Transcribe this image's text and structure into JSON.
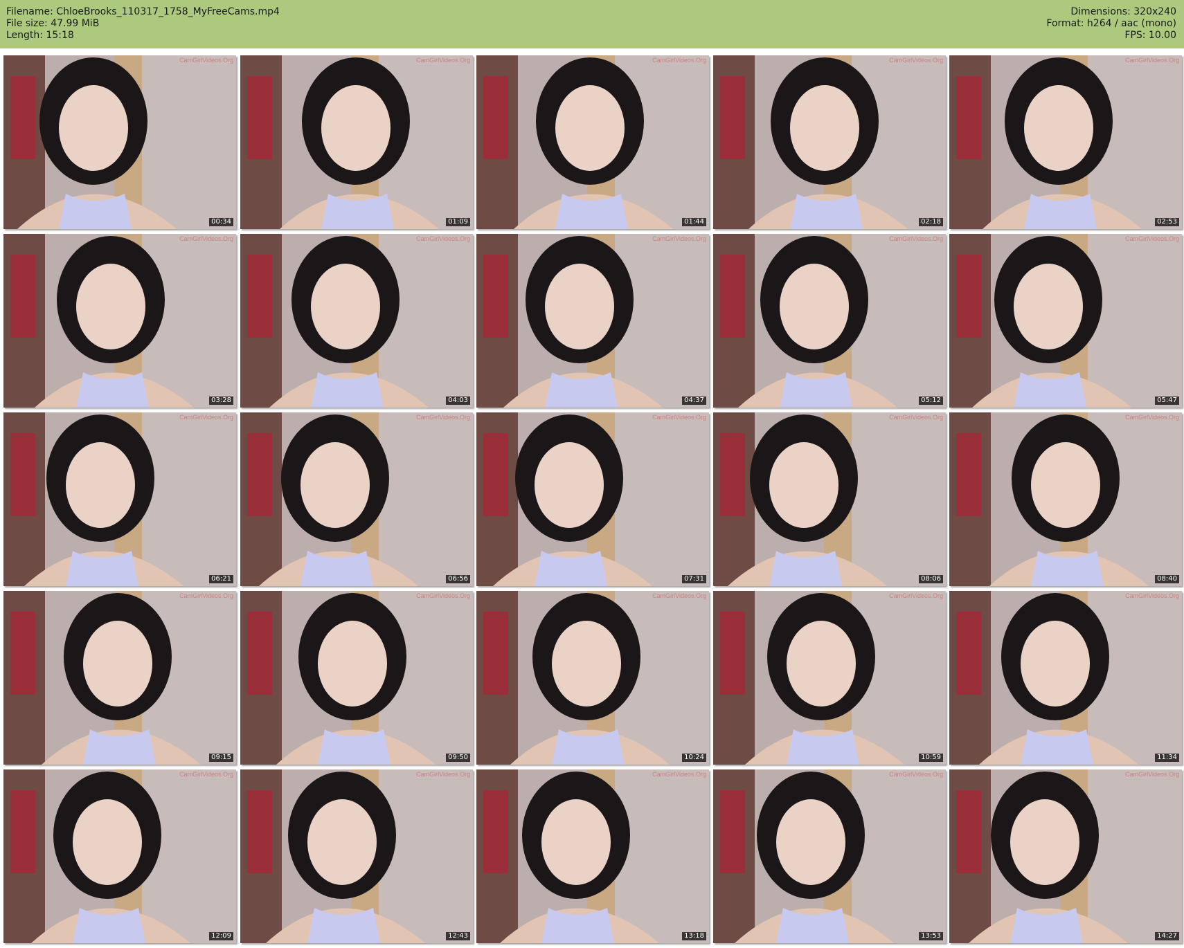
{
  "header": {
    "filename_label": "Filename: ChloeBrooks_110317_1758_MyFreeCams.mp4",
    "filesize_label": "File size: 47.99 MiB",
    "length_label": "Length: 15:18",
    "dimensions_label": "Dimensions: 320x240",
    "format_label": "Format: h264 / aac (mono)",
    "fps_label": "FPS: 10.00",
    "background_color": "#adc97e"
  },
  "watermark": "CamGirlVideos.Org",
  "thumbnails": [
    {
      "timestamp": "00:34"
    },
    {
      "timestamp": "01:09"
    },
    {
      "timestamp": "01:44"
    },
    {
      "timestamp": "02:18"
    },
    {
      "timestamp": "02:53"
    },
    {
      "timestamp": "03:28"
    },
    {
      "timestamp": "04:03"
    },
    {
      "timestamp": "04:37"
    },
    {
      "timestamp": "05:12"
    },
    {
      "timestamp": "05:47"
    },
    {
      "timestamp": "06:21"
    },
    {
      "timestamp": "06:56"
    },
    {
      "timestamp": "07:31"
    },
    {
      "timestamp": "08:06"
    },
    {
      "timestamp": "08:40"
    },
    {
      "timestamp": "09:15"
    },
    {
      "timestamp": "09:50"
    },
    {
      "timestamp": "10:24"
    },
    {
      "timestamp": "10:59"
    },
    {
      "timestamp": "11:34"
    },
    {
      "timestamp": "12:09"
    },
    {
      "timestamp": "12:43"
    },
    {
      "timestamp": "13:18"
    },
    {
      "timestamp": "13:53"
    },
    {
      "timestamp": "14:27"
    }
  ]
}
